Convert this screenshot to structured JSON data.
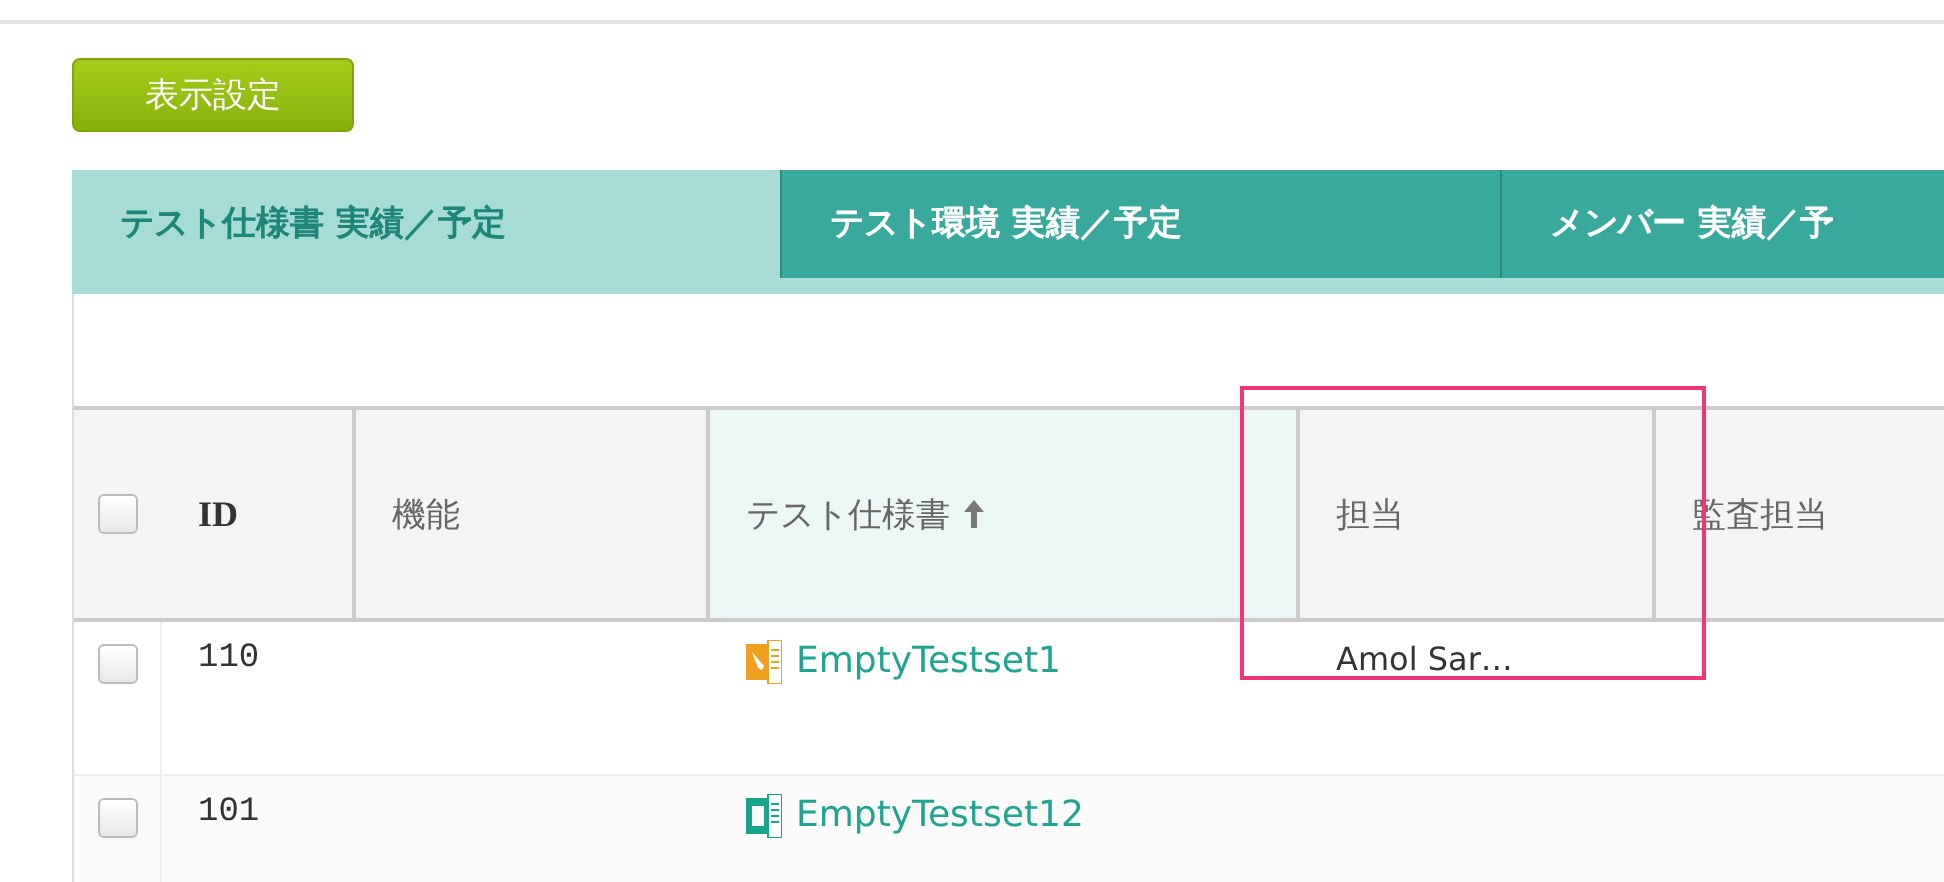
{
  "display_settings_button": "表示設定",
  "tabs": [
    {
      "label": "テスト仕様書 実績／予定",
      "selected": true
    },
    {
      "label": "テスト環境 実績／予定",
      "selected": false
    },
    {
      "label": "メンバー 実績／予",
      "selected": false
    }
  ],
  "table": {
    "select_all": {
      "checked": false
    },
    "columns": [
      {
        "label": "ID",
        "sorted": false
      },
      {
        "label": "機能",
        "sorted": false
      },
      {
        "label": "テスト仕様書",
        "sorted": true
      },
      {
        "label": "担当",
        "sorted": false
      },
      {
        "label": "監査担当",
        "sorted": false
      }
    ],
    "rows": [
      {
        "checked": false,
        "id": "110",
        "testset": "EmptyTestset1",
        "kind": "edit",
        "assignee": "Amol Sar…"
      },
      {
        "checked": false,
        "id": "101",
        "testset": "EmptyTestset12",
        "kind": "sheet"
      }
    ]
  }
}
